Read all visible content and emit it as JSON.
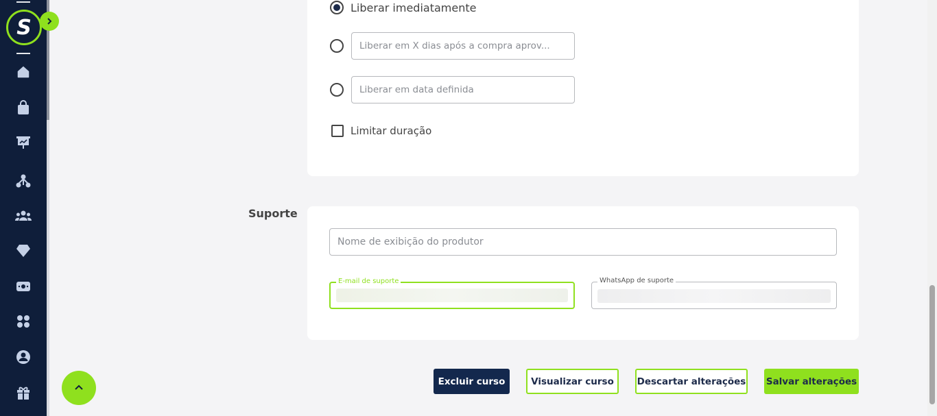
{
  "release": {
    "options": [
      {
        "label": "Liberar imediatamente",
        "checked": true
      },
      {
        "placeholder": "Liberar em X dias após a compra aprov...",
        "checked": false
      },
      {
        "placeholder": "Liberar em data definida",
        "checked": false
      }
    ],
    "limit_duration_label": "Limitar duração"
  },
  "support": {
    "section_label": "Suporte",
    "producer_name_placeholder": "Nome de exibição do produtor",
    "email_label": "E-mail de suporte",
    "whatsapp_label": "WhatsApp de suporte"
  },
  "actions": {
    "delete_label": "Excluir curso",
    "view_label": "Visualizar curso",
    "discard_label": "Descartar alterações",
    "save_label": "Salvar alterações"
  },
  "sidebar": {
    "logo_letter": "S",
    "icons": [
      "home-icon",
      "bag-icon",
      "presentation-chart-icon",
      "network-icon",
      "users-icon",
      "diamond-icon",
      "money-icon",
      "apps-icon",
      "profile-icon",
      "gift-icon"
    ]
  },
  "colors": {
    "accent": "#8fe01e",
    "sidebar_bg": "#0f1e3a",
    "dark_button": "#13284d",
    "icon": "#c4d0e6"
  }
}
